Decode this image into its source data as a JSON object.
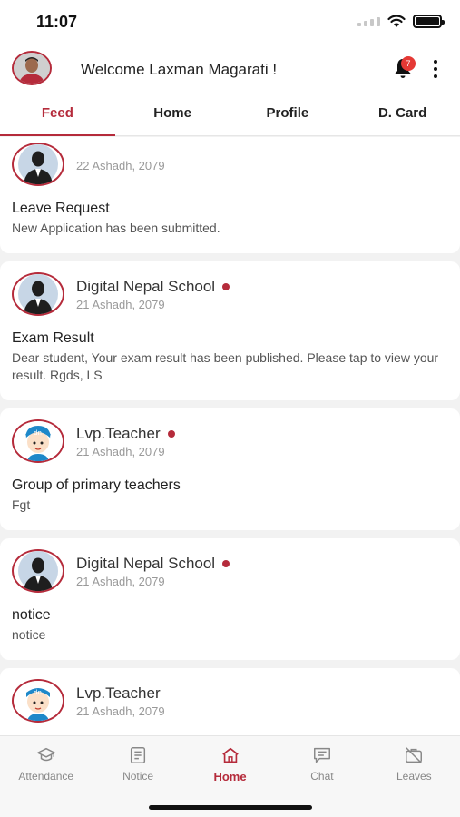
{
  "status_bar": {
    "time": "11:07"
  },
  "header": {
    "welcome": "Welcome Laxman Magarati !",
    "notification_count": "7",
    "icons": {
      "bell": "bell-icon",
      "menu": "more-vertical-icon"
    }
  },
  "tabs": [
    {
      "label": "Feed",
      "active": true
    },
    {
      "label": "Home",
      "active": false
    },
    {
      "label": "Profile",
      "active": false
    },
    {
      "label": "D. Card",
      "active": false
    }
  ],
  "feed": [
    {
      "sender": "",
      "date": "22 Ashadh, 2079",
      "unread": false,
      "avatar": "person-silhouette-icon",
      "title": "Leave Request",
      "body": "New Application has been submitted."
    },
    {
      "sender": "Digital Nepal School",
      "date": "21 Ashadh, 2079",
      "unread": true,
      "avatar": "person-silhouette-icon",
      "title": "Exam Result",
      "body": "Dear student, Your exam result has been published. Please tap to view your result. Rgds, LS"
    },
    {
      "sender": "Lvp.Teacher",
      "date": "21 Ashadh, 2079",
      "unread": true,
      "avatar": "cartoon-student-icon",
      "title": "Group of primary teachers",
      "body": "Fgt"
    },
    {
      "sender": "Digital Nepal School",
      "date": "21 Ashadh, 2079",
      "unread": true,
      "avatar": "person-silhouette-icon",
      "title": "notice",
      "body": "notice"
    },
    {
      "sender": "Lvp.Teacher",
      "date": "21 Ashadh, 2079",
      "unread": false,
      "avatar": "cartoon-student-icon",
      "title": "",
      "body": ""
    }
  ],
  "bottom_nav": [
    {
      "label": "Attendance",
      "icon": "graduation-cap-icon",
      "active": false
    },
    {
      "label": "Notice",
      "icon": "document-icon",
      "active": false
    },
    {
      "label": "Home",
      "icon": "home-icon",
      "active": true
    },
    {
      "label": "Chat",
      "icon": "chat-icon",
      "active": false
    },
    {
      "label": "Leaves",
      "icon": "briefcase-off-icon",
      "active": false
    }
  ],
  "colors": {
    "accent": "#b52b3b",
    "badge": "#e53935",
    "background": "#f2f2f2"
  }
}
